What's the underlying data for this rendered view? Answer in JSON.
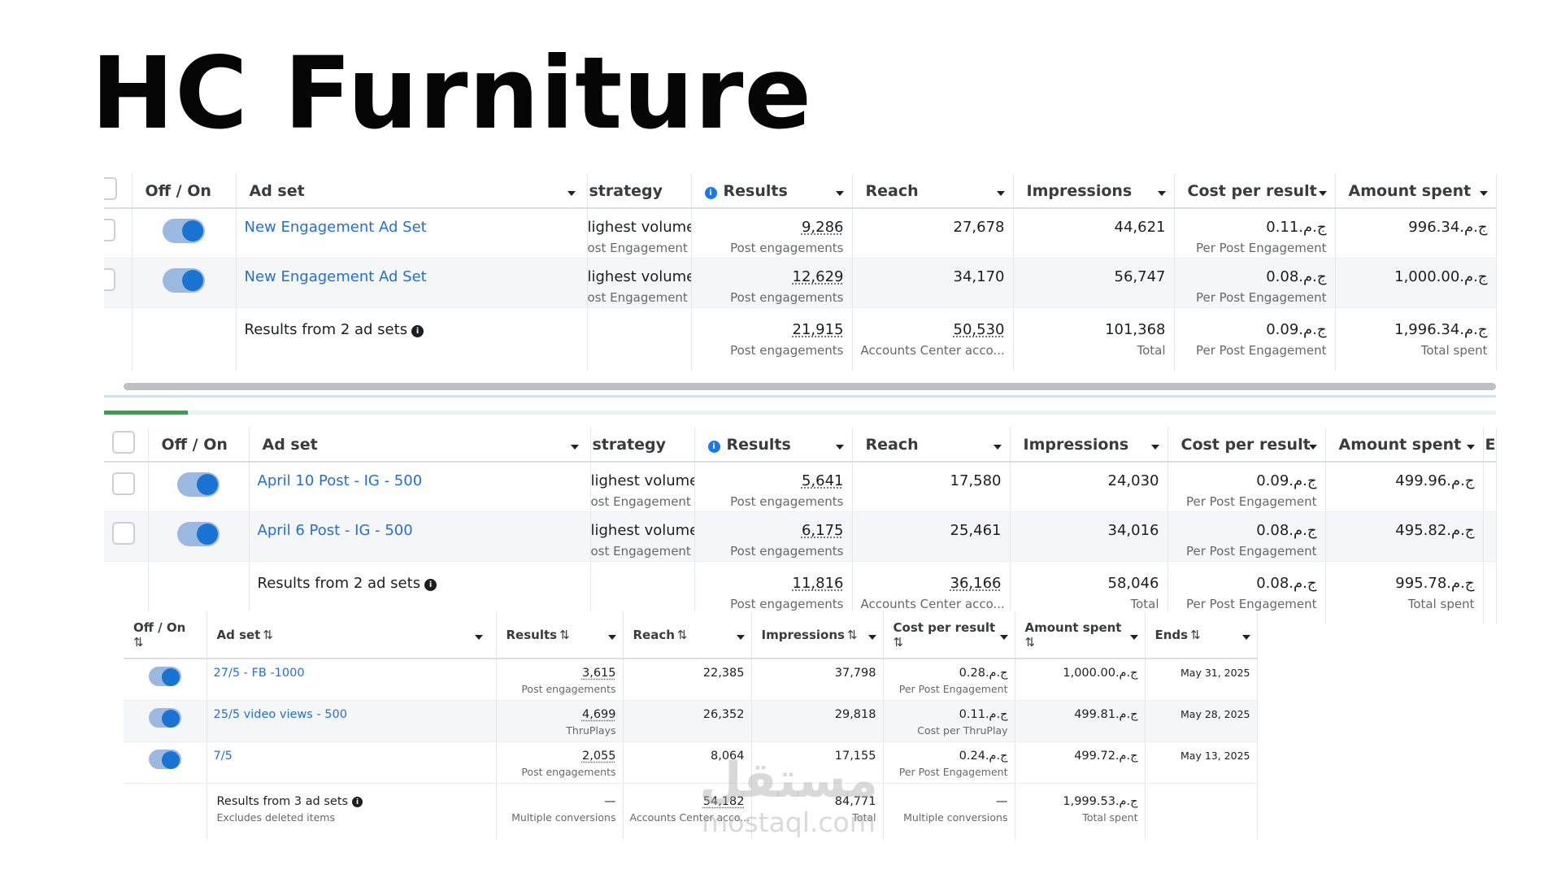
{
  "title": "HC Furniture",
  "colors": {
    "link": "#216fdb",
    "toggle_on": "#1873d3",
    "progress": "#2ea44f"
  },
  "icons": [
    "info-icon",
    "toggle-icon",
    "checkbox-icon",
    "dropdown-caret-icon",
    "sort-icon"
  ],
  "table1": {
    "headers": {
      "toggle": "Off / On",
      "adset": "Ad set",
      "strategy": "strategy",
      "results": "Results",
      "reach": "Reach",
      "impressions": "Impressions",
      "cost": "Cost per result",
      "amount": "Amount spent"
    },
    "rows": [
      {
        "name": "New Engagement Ad Set",
        "strategy": "lighest volume",
        "strategy_sub": "ost Engagement",
        "results": "9,286",
        "results_sub": "Post engagements",
        "reach": "27,678",
        "impressions": "44,621",
        "cost": "ج.م.0.11",
        "cost_sub": "Per Post Engagement",
        "amount": "ج.م.996.34"
      },
      {
        "name": "New Engagement Ad Set",
        "strategy": "lighest volume",
        "strategy_sub": "ost Engagement",
        "results": "12,629",
        "results_sub": "Post engagements",
        "reach": "34,170",
        "impressions": "56,747",
        "cost": "ج.م.0.08",
        "cost_sub": "Per Post Engagement",
        "amount": "ج.م.1,000.00"
      }
    ],
    "summary": {
      "label": "Results from 2 ad sets",
      "results": "21,915",
      "results_sub": "Post engagements",
      "reach": "50,530",
      "reach_sub": "Accounts Center acco...",
      "impressions": "101,368",
      "impressions_sub": "Total",
      "cost": "ج.م.0.09",
      "cost_sub": "Per Post Engagement",
      "amount": "ج.م.1,996.34",
      "amount_sub": "Total spent"
    }
  },
  "table2": {
    "headers": {
      "toggle": "Off / On",
      "adset": "Ad set",
      "strategy": "strategy",
      "results": "Results",
      "reach": "Reach",
      "impressions": "Impressions",
      "cost": "Cost per result",
      "amount": "Amount spent",
      "extra": "E"
    },
    "rows": [
      {
        "name": "April 10 Post - IG - 500",
        "strategy": "lighest volume",
        "strategy_sub": "ost Engagement",
        "results": "5,641",
        "results_sub": "Post engagements",
        "reach": "17,580",
        "impressions": "24,030",
        "cost": "ج.م.0.09",
        "cost_sub": "Per Post Engagement",
        "amount": "ج.م.499.96"
      },
      {
        "name": "April 6 Post - IG - 500",
        "strategy": "lighest volume",
        "strategy_sub": "ost Engagement",
        "results": "6,175",
        "results_sub": "Post engagements",
        "reach": "25,461",
        "impressions": "34,016",
        "cost": "ج.م.0.08",
        "cost_sub": "Per Post Engagement",
        "amount": "ج.م.495.82"
      }
    ],
    "summary": {
      "label": "Results from 2 ad sets",
      "results": "11,816",
      "results_sub": "Post engagements",
      "reach": "36,166",
      "reach_sub": "Accounts Center acco...",
      "impressions": "58,046",
      "impressions_sub": "Total",
      "cost": "ج.م.0.08",
      "cost_sub": "Per Post Engagement",
      "amount": "ج.م.995.78",
      "amount_sub": "Total spent"
    }
  },
  "table3": {
    "headers": {
      "toggle": "Off / On",
      "adset": "Ad set",
      "results": "Results",
      "reach": "Reach",
      "impressions": "Impressions",
      "cost": "Cost per result",
      "amount": "Amount spent",
      "ends": "Ends"
    },
    "sort_glyph": "⇅",
    "rows": [
      {
        "name": "27/5 - FB -1000",
        "results": "3,615",
        "results_sub": "Post engagements",
        "reach": "22,385",
        "impressions": "37,798",
        "cost": "ج.م.0.28",
        "cost_sub": "Per Post Engagement",
        "amount": "ج.م.1,000.00",
        "ends": "May 31, 2025"
      },
      {
        "name": "25/5 video views - 500",
        "results": "4,699",
        "results_sub": "ThruPlays",
        "reach": "26,352",
        "impressions": "29,818",
        "cost": "ج.م.0.11",
        "cost_sub": "Cost per ThruPlay",
        "amount": "ج.م.499.81",
        "ends": "May 28, 2025"
      },
      {
        "name": "7/5",
        "results": "2,055",
        "results_sub": "Post engagements",
        "reach": "8,064",
        "impressions": "17,155",
        "cost": "ج.م.0.24",
        "cost_sub": "Per Post Engagement",
        "amount": "ج.م.499.72",
        "ends": "May 13, 2025"
      }
    ],
    "summary": {
      "label": "Results from 3 ad sets",
      "label_sub": "Excludes deleted items",
      "results": "—",
      "results_sub": "Multiple conversions",
      "reach": "54,182",
      "reach_sub": "Accounts Center acco...",
      "impressions": "84,771",
      "impressions_sub": "Total",
      "cost": "—",
      "cost_sub": "Multiple conversions",
      "amount": "ج.م.1,999.53",
      "amount_sub": "Total spent"
    }
  },
  "watermark": {
    "logo": "مستقل",
    "domain": "mostaql.com"
  }
}
